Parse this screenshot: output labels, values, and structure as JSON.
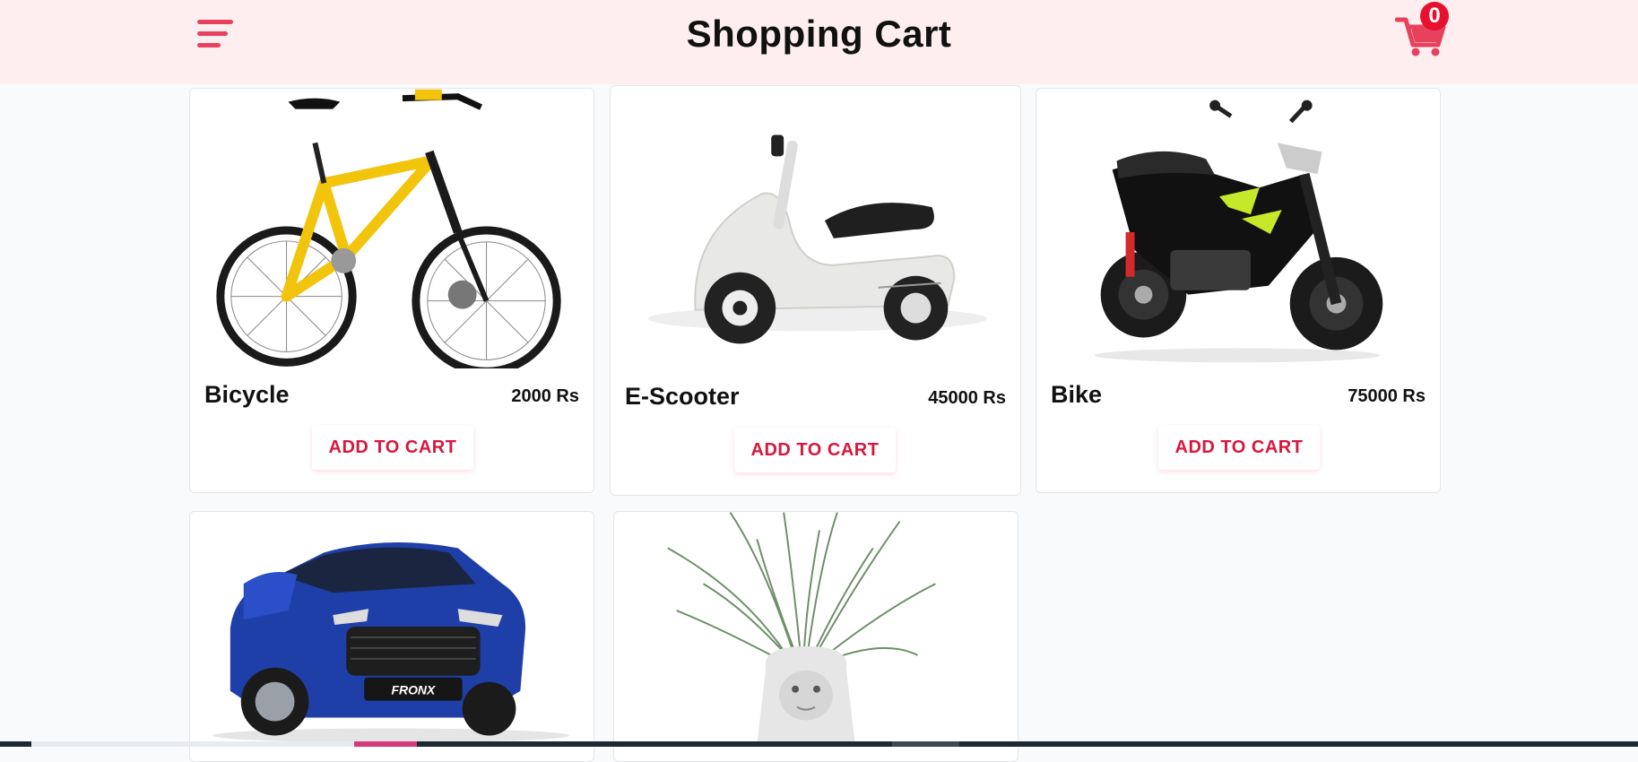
{
  "header": {
    "title": "Shopping Cart",
    "cart_count": "0",
    "accent_color": "#e8415d",
    "menu_icon": "hamburger-menu-icon",
    "cart_icon": "shopping-cart-icon"
  },
  "products": [
    {
      "name": "Bicycle",
      "price": "2000 Rs",
      "button": "ADD TO CART",
      "image": "yellow-bicycle"
    },
    {
      "name": "E-Scooter",
      "price": "45000 Rs",
      "button": "ADD TO CART",
      "image": "white-electric-scooter"
    },
    {
      "name": "Bike",
      "price": "75000 Rs",
      "button": "ADD TO CART",
      "image": "black-motorcycle"
    },
    {
      "name": "",
      "price": "",
      "button": "",
      "image": "blue-car"
    },
    {
      "name": "",
      "price": "",
      "button": "",
      "image": "gorilla-planter"
    }
  ],
  "car_badge_text": "FRONX"
}
